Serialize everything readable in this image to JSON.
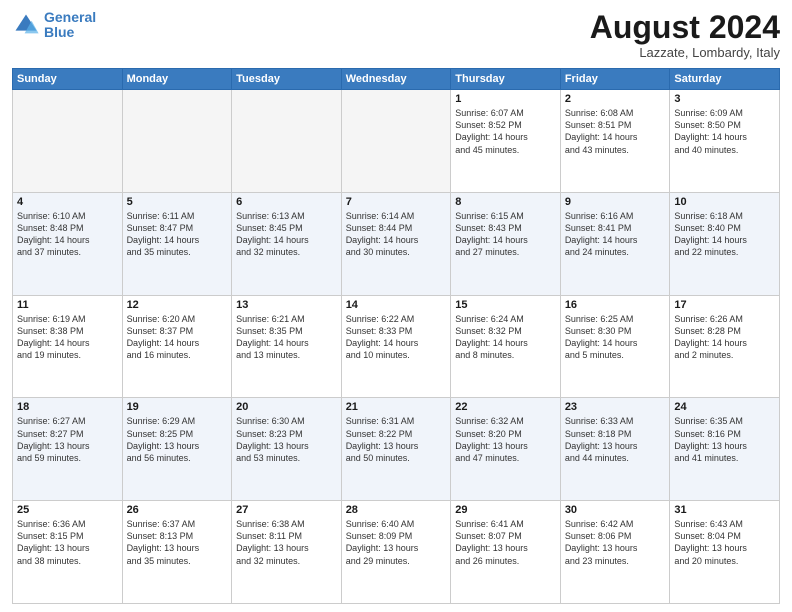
{
  "header": {
    "logo_line1": "General",
    "logo_line2": "Blue",
    "month_year": "August 2024",
    "location": "Lazzate, Lombardy, Italy"
  },
  "days_of_week": [
    "Sunday",
    "Monday",
    "Tuesday",
    "Wednesday",
    "Thursday",
    "Friday",
    "Saturday"
  ],
  "weeks": [
    [
      {
        "day": "",
        "empty": true
      },
      {
        "day": "",
        "empty": true
      },
      {
        "day": "",
        "empty": true
      },
      {
        "day": "",
        "empty": true
      },
      {
        "day": "1",
        "rise": "6:07 AM",
        "set": "8:52 PM",
        "hours": "14 hours",
        "mins": "and 45 minutes."
      },
      {
        "day": "2",
        "rise": "6:08 AM",
        "set": "8:51 PM",
        "hours": "14 hours",
        "mins": "and 43 minutes."
      },
      {
        "day": "3",
        "rise": "6:09 AM",
        "set": "8:50 PM",
        "hours": "14 hours",
        "mins": "and 40 minutes."
      }
    ],
    [
      {
        "day": "4",
        "rise": "6:10 AM",
        "set": "8:48 PM",
        "hours": "14 hours",
        "mins": "and 37 minutes."
      },
      {
        "day": "5",
        "rise": "6:11 AM",
        "set": "8:47 PM",
        "hours": "14 hours",
        "mins": "and 35 minutes."
      },
      {
        "day": "6",
        "rise": "6:13 AM",
        "set": "8:45 PM",
        "hours": "14 hours",
        "mins": "and 32 minutes."
      },
      {
        "day": "7",
        "rise": "6:14 AM",
        "set": "8:44 PM",
        "hours": "14 hours",
        "mins": "and 30 minutes."
      },
      {
        "day": "8",
        "rise": "6:15 AM",
        "set": "8:43 PM",
        "hours": "14 hours",
        "mins": "and 27 minutes."
      },
      {
        "day": "9",
        "rise": "6:16 AM",
        "set": "8:41 PM",
        "hours": "14 hours",
        "mins": "and 24 minutes."
      },
      {
        "day": "10",
        "rise": "6:18 AM",
        "set": "8:40 PM",
        "hours": "14 hours",
        "mins": "and 22 minutes."
      }
    ],
    [
      {
        "day": "11",
        "rise": "6:19 AM",
        "set": "8:38 PM",
        "hours": "14 hours",
        "mins": "and 19 minutes."
      },
      {
        "day": "12",
        "rise": "6:20 AM",
        "set": "8:37 PM",
        "hours": "14 hours",
        "mins": "and 16 minutes."
      },
      {
        "day": "13",
        "rise": "6:21 AM",
        "set": "8:35 PM",
        "hours": "14 hours",
        "mins": "and 13 minutes."
      },
      {
        "day": "14",
        "rise": "6:22 AM",
        "set": "8:33 PM",
        "hours": "14 hours",
        "mins": "and 10 minutes."
      },
      {
        "day": "15",
        "rise": "6:24 AM",
        "set": "8:32 PM",
        "hours": "14 hours",
        "mins": "and 8 minutes."
      },
      {
        "day": "16",
        "rise": "6:25 AM",
        "set": "8:30 PM",
        "hours": "14 hours",
        "mins": "and 5 minutes."
      },
      {
        "day": "17",
        "rise": "6:26 AM",
        "set": "8:28 PM",
        "hours": "14 hours",
        "mins": "and 2 minutes."
      }
    ],
    [
      {
        "day": "18",
        "rise": "6:27 AM",
        "set": "8:27 PM",
        "hours": "13 hours",
        "mins": "and 59 minutes."
      },
      {
        "day": "19",
        "rise": "6:29 AM",
        "set": "8:25 PM",
        "hours": "13 hours",
        "mins": "and 56 minutes."
      },
      {
        "day": "20",
        "rise": "6:30 AM",
        "set": "8:23 PM",
        "hours": "13 hours",
        "mins": "and 53 minutes."
      },
      {
        "day": "21",
        "rise": "6:31 AM",
        "set": "8:22 PM",
        "hours": "13 hours",
        "mins": "and 50 minutes."
      },
      {
        "day": "22",
        "rise": "6:32 AM",
        "set": "8:20 PM",
        "hours": "13 hours",
        "mins": "and 47 minutes."
      },
      {
        "day": "23",
        "rise": "6:33 AM",
        "set": "8:18 PM",
        "hours": "13 hours",
        "mins": "and 44 minutes."
      },
      {
        "day": "24",
        "rise": "6:35 AM",
        "set": "8:16 PM",
        "hours": "13 hours",
        "mins": "and 41 minutes."
      }
    ],
    [
      {
        "day": "25",
        "rise": "6:36 AM",
        "set": "8:15 PM",
        "hours": "13 hours",
        "mins": "and 38 minutes."
      },
      {
        "day": "26",
        "rise": "6:37 AM",
        "set": "8:13 PM",
        "hours": "13 hours",
        "mins": "and 35 minutes."
      },
      {
        "day": "27",
        "rise": "6:38 AM",
        "set": "8:11 PM",
        "hours": "13 hours",
        "mins": "and 32 minutes."
      },
      {
        "day": "28",
        "rise": "6:40 AM",
        "set": "8:09 PM",
        "hours": "13 hours",
        "mins": "and 29 minutes."
      },
      {
        "day": "29",
        "rise": "6:41 AM",
        "set": "8:07 PM",
        "hours": "13 hours",
        "mins": "and 26 minutes."
      },
      {
        "day": "30",
        "rise": "6:42 AM",
        "set": "8:06 PM",
        "hours": "13 hours",
        "mins": "and 23 minutes."
      },
      {
        "day": "31",
        "rise": "6:43 AM",
        "set": "8:04 PM",
        "hours": "13 hours",
        "mins": "and 20 minutes."
      }
    ]
  ]
}
